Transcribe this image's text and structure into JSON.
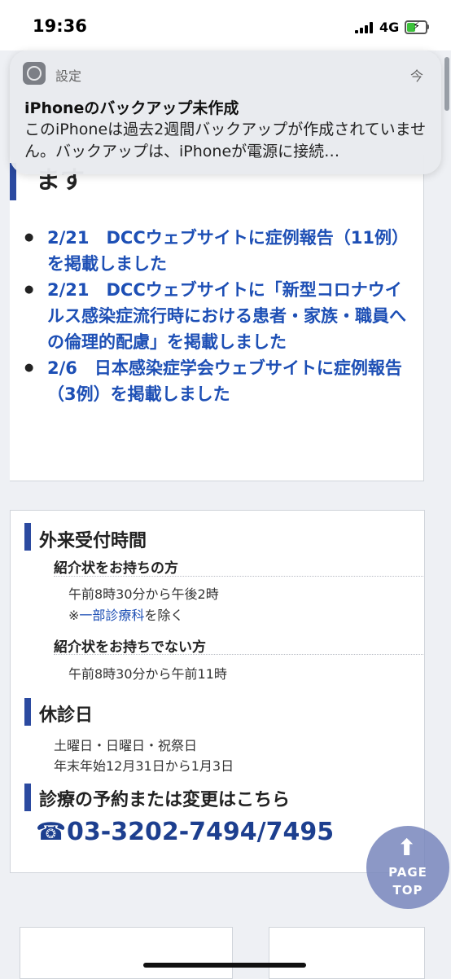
{
  "status_bar": {
    "time": "19:36",
    "network": "4G"
  },
  "notification": {
    "app": "設定",
    "time": "今",
    "title": "iPhoneのバックアップ未作成",
    "body": "このiPhoneは過去2週間バックアップが作成されていません。バックアップは、iPhoneが電源に接続…"
  },
  "news": {
    "heading": "ます",
    "items": [
      "2/21　DCCウェブサイトに症例報告（11例）を掲載しました",
      "2/21　DCCウェブサイトに「新型コロナウイルス感染症流行時における患者・家族・職員への倫理的配慮」を掲載しました",
      "2/6　日本感染症学会ウェブサイトに症例報告（3例）を掲載しました"
    ]
  },
  "hours": {
    "title": "外来受付時間",
    "with_referral_title": "紹介状をお持ちの方",
    "with_referral_time": "午前8時30分から午後2時",
    "note_prefix": "※",
    "note_link": "一部診療科",
    "note_suffix": "を除く",
    "without_referral_title": "紹介状をお持ちでない方",
    "without_referral_time": "午前8時30分から午前11時"
  },
  "closed": {
    "title": "休診日",
    "line1": "土曜日・日曜日・祝祭日",
    "line2": "年末年始12月31日から1月3日"
  },
  "booking": {
    "title": "診療の予約または変更はこちら",
    "phone": "03-3202-7494/7495"
  },
  "page_top": {
    "arrow": "⬆",
    "line1": "PAGE",
    "line2": "TOP"
  }
}
